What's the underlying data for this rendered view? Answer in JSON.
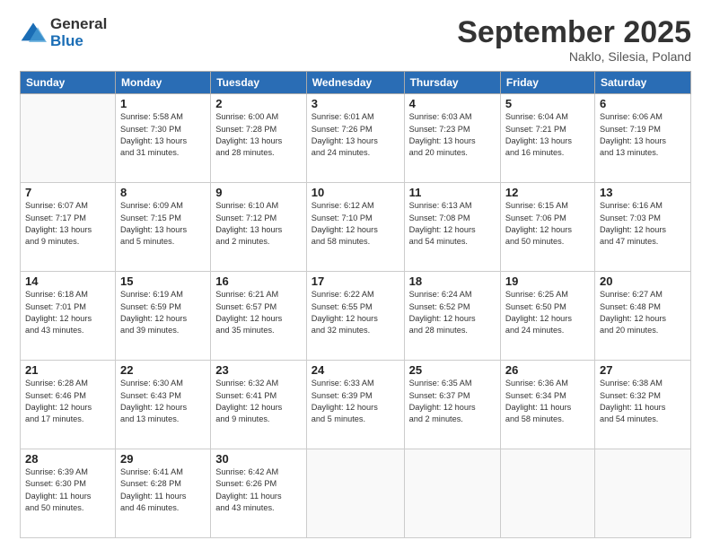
{
  "logo": {
    "general": "General",
    "blue": "Blue"
  },
  "header": {
    "month": "September 2025",
    "location": "Naklo, Silesia, Poland"
  },
  "weekdays": [
    "Sunday",
    "Monday",
    "Tuesday",
    "Wednesday",
    "Thursday",
    "Friday",
    "Saturday"
  ],
  "weeks": [
    [
      {
        "num": "",
        "info": ""
      },
      {
        "num": "1",
        "info": "Sunrise: 5:58 AM\nSunset: 7:30 PM\nDaylight: 13 hours\nand 31 minutes."
      },
      {
        "num": "2",
        "info": "Sunrise: 6:00 AM\nSunset: 7:28 PM\nDaylight: 13 hours\nand 28 minutes."
      },
      {
        "num": "3",
        "info": "Sunrise: 6:01 AM\nSunset: 7:26 PM\nDaylight: 13 hours\nand 24 minutes."
      },
      {
        "num": "4",
        "info": "Sunrise: 6:03 AM\nSunset: 7:23 PM\nDaylight: 13 hours\nand 20 minutes."
      },
      {
        "num": "5",
        "info": "Sunrise: 6:04 AM\nSunset: 7:21 PM\nDaylight: 13 hours\nand 16 minutes."
      },
      {
        "num": "6",
        "info": "Sunrise: 6:06 AM\nSunset: 7:19 PM\nDaylight: 13 hours\nand 13 minutes."
      }
    ],
    [
      {
        "num": "7",
        "info": "Sunrise: 6:07 AM\nSunset: 7:17 PM\nDaylight: 13 hours\nand 9 minutes."
      },
      {
        "num": "8",
        "info": "Sunrise: 6:09 AM\nSunset: 7:15 PM\nDaylight: 13 hours\nand 5 minutes."
      },
      {
        "num": "9",
        "info": "Sunrise: 6:10 AM\nSunset: 7:12 PM\nDaylight: 13 hours\nand 2 minutes."
      },
      {
        "num": "10",
        "info": "Sunrise: 6:12 AM\nSunset: 7:10 PM\nDaylight: 12 hours\nand 58 minutes."
      },
      {
        "num": "11",
        "info": "Sunrise: 6:13 AM\nSunset: 7:08 PM\nDaylight: 12 hours\nand 54 minutes."
      },
      {
        "num": "12",
        "info": "Sunrise: 6:15 AM\nSunset: 7:06 PM\nDaylight: 12 hours\nand 50 minutes."
      },
      {
        "num": "13",
        "info": "Sunrise: 6:16 AM\nSunset: 7:03 PM\nDaylight: 12 hours\nand 47 minutes."
      }
    ],
    [
      {
        "num": "14",
        "info": "Sunrise: 6:18 AM\nSunset: 7:01 PM\nDaylight: 12 hours\nand 43 minutes."
      },
      {
        "num": "15",
        "info": "Sunrise: 6:19 AM\nSunset: 6:59 PM\nDaylight: 12 hours\nand 39 minutes."
      },
      {
        "num": "16",
        "info": "Sunrise: 6:21 AM\nSunset: 6:57 PM\nDaylight: 12 hours\nand 35 minutes."
      },
      {
        "num": "17",
        "info": "Sunrise: 6:22 AM\nSunset: 6:55 PM\nDaylight: 12 hours\nand 32 minutes."
      },
      {
        "num": "18",
        "info": "Sunrise: 6:24 AM\nSunset: 6:52 PM\nDaylight: 12 hours\nand 28 minutes."
      },
      {
        "num": "19",
        "info": "Sunrise: 6:25 AM\nSunset: 6:50 PM\nDaylight: 12 hours\nand 24 minutes."
      },
      {
        "num": "20",
        "info": "Sunrise: 6:27 AM\nSunset: 6:48 PM\nDaylight: 12 hours\nand 20 minutes."
      }
    ],
    [
      {
        "num": "21",
        "info": "Sunrise: 6:28 AM\nSunset: 6:46 PM\nDaylight: 12 hours\nand 17 minutes."
      },
      {
        "num": "22",
        "info": "Sunrise: 6:30 AM\nSunset: 6:43 PM\nDaylight: 12 hours\nand 13 minutes."
      },
      {
        "num": "23",
        "info": "Sunrise: 6:32 AM\nSunset: 6:41 PM\nDaylight: 12 hours\nand 9 minutes."
      },
      {
        "num": "24",
        "info": "Sunrise: 6:33 AM\nSunset: 6:39 PM\nDaylight: 12 hours\nand 5 minutes."
      },
      {
        "num": "25",
        "info": "Sunrise: 6:35 AM\nSunset: 6:37 PM\nDaylight: 12 hours\nand 2 minutes."
      },
      {
        "num": "26",
        "info": "Sunrise: 6:36 AM\nSunset: 6:34 PM\nDaylight: 11 hours\nand 58 minutes."
      },
      {
        "num": "27",
        "info": "Sunrise: 6:38 AM\nSunset: 6:32 PM\nDaylight: 11 hours\nand 54 minutes."
      }
    ],
    [
      {
        "num": "28",
        "info": "Sunrise: 6:39 AM\nSunset: 6:30 PM\nDaylight: 11 hours\nand 50 minutes."
      },
      {
        "num": "29",
        "info": "Sunrise: 6:41 AM\nSunset: 6:28 PM\nDaylight: 11 hours\nand 46 minutes."
      },
      {
        "num": "30",
        "info": "Sunrise: 6:42 AM\nSunset: 6:26 PM\nDaylight: 11 hours\nand 43 minutes."
      },
      {
        "num": "",
        "info": ""
      },
      {
        "num": "",
        "info": ""
      },
      {
        "num": "",
        "info": ""
      },
      {
        "num": "",
        "info": ""
      }
    ]
  ]
}
